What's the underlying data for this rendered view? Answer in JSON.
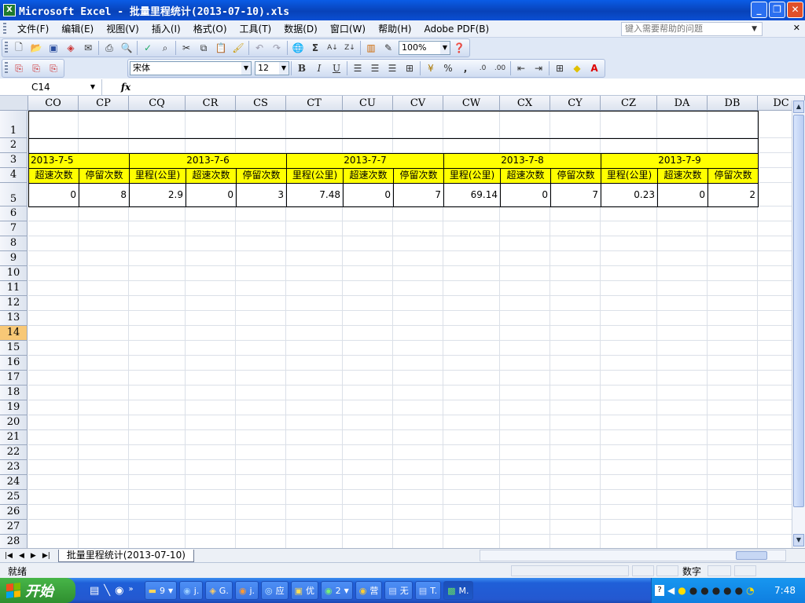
{
  "window": {
    "title": "Microsoft Excel - 批量里程统计(2013-07-10).xls",
    "icon_letter": "X"
  },
  "menu": {
    "items": [
      "文件(F)",
      "编辑(E)",
      "视图(V)",
      "插入(I)",
      "格式(O)",
      "工具(T)",
      "数据(D)",
      "窗口(W)",
      "帮助(H)",
      "Adobe PDF(B)"
    ],
    "help_placeholder": "键入需要帮助的问题"
  },
  "toolbar": {
    "zoom": "100%",
    "font": "宋体",
    "font_size": "12"
  },
  "formula_bar": {
    "name_box": "C14",
    "fx": "fx",
    "content": ""
  },
  "columns": [
    "CO",
    "CP",
    "CQ",
    "CR",
    "CS",
    "CT",
    "CU",
    "CV",
    "CW",
    "CX",
    "CY",
    "CZ",
    "DA",
    "DB",
    "DC"
  ],
  "rows": [
    "1",
    "2",
    "3",
    "4",
    "5",
    "6",
    "7",
    "8",
    "9",
    "10",
    "11",
    "12",
    "13",
    "14",
    "15",
    "16",
    "17",
    "18",
    "19",
    "20",
    "21",
    "22",
    "23",
    "24",
    "25",
    "26",
    "27",
    "28"
  ],
  "selected_row": "14",
  "dates": [
    "2013-7-5",
    "2013-7-6",
    "2013-7-7",
    "2013-7-8",
    "2013-7-9"
  ],
  "subheaders": [
    "超速次数",
    "停留次数",
    "里程(公里)",
    "超速次数",
    "停留次数",
    "里程(公里)",
    "超速次数",
    "停留次数",
    "里程(公里)",
    "超速次数",
    "停留次数",
    "里程(公里)",
    "超速次数",
    "停留次数"
  ],
  "values": [
    "0",
    "8",
    "2.9",
    "0",
    "3",
    "7.48",
    "0",
    "7",
    "69.14",
    "0",
    "7",
    "0.23",
    "0",
    "2"
  ],
  "sheet_tab": "批量里程统计(2013-07-10)",
  "status": {
    "ready": "就绪",
    "mode": "数字"
  },
  "taskbar": {
    "start": "开始",
    "tasks": [
      "9",
      "j.",
      "G.",
      "j.",
      "应",
      "优",
      "2",
      "营",
      "无",
      "T.",
      "M."
    ],
    "clock": "7:48"
  },
  "colors": {
    "header_fill": "#ffff00",
    "title_bar": "#0842b8",
    "selected_row": "#f8c876"
  }
}
